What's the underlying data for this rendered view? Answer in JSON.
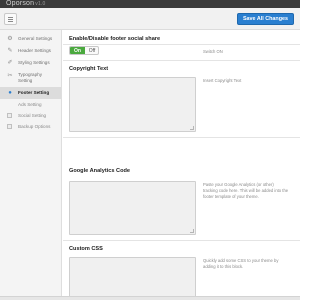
{
  "header": {
    "brand": "Oporson",
    "version": "v1.0"
  },
  "toolbar": {
    "save_label": "Save All Changes"
  },
  "sidebar": {
    "items": [
      {
        "label": "General Settings",
        "icon": "gear-icon"
      },
      {
        "label": "Header Settings",
        "icon": "pencil-icon"
      },
      {
        "label": "Styling Settings",
        "icon": "brush-icon"
      },
      {
        "label": "Typography Setting",
        "icon": "wrench-icon"
      },
      {
        "label": "Footer Setting",
        "icon": "footer-icon",
        "active": true
      }
    ],
    "sub_items": [
      {
        "label": "Ads Setting"
      },
      {
        "label": "Social Setting"
      },
      {
        "label": "Backup Options"
      }
    ]
  },
  "main": {
    "social": {
      "title": "Enable/Disable footer social share",
      "on_label": "On",
      "off_label": "Off",
      "help": "Switch ON"
    },
    "copyright": {
      "title": "Copyright Text",
      "help": "Insert Copyright Text",
      "value": ""
    },
    "analytics": {
      "title": "Google Analytics Code",
      "help": "Paste your Google Analytics (or other) tracking code here. This will be added into the footer template of your theme.",
      "value": ""
    },
    "css": {
      "title": "Custom CSS",
      "help": "Quickly add some CSS to your theme by adding it to this block.",
      "value": ""
    }
  },
  "colors": {
    "accent": "#2a7fd0",
    "switch_on": "#4aa93e",
    "header_bg": "#3a3a3a"
  }
}
